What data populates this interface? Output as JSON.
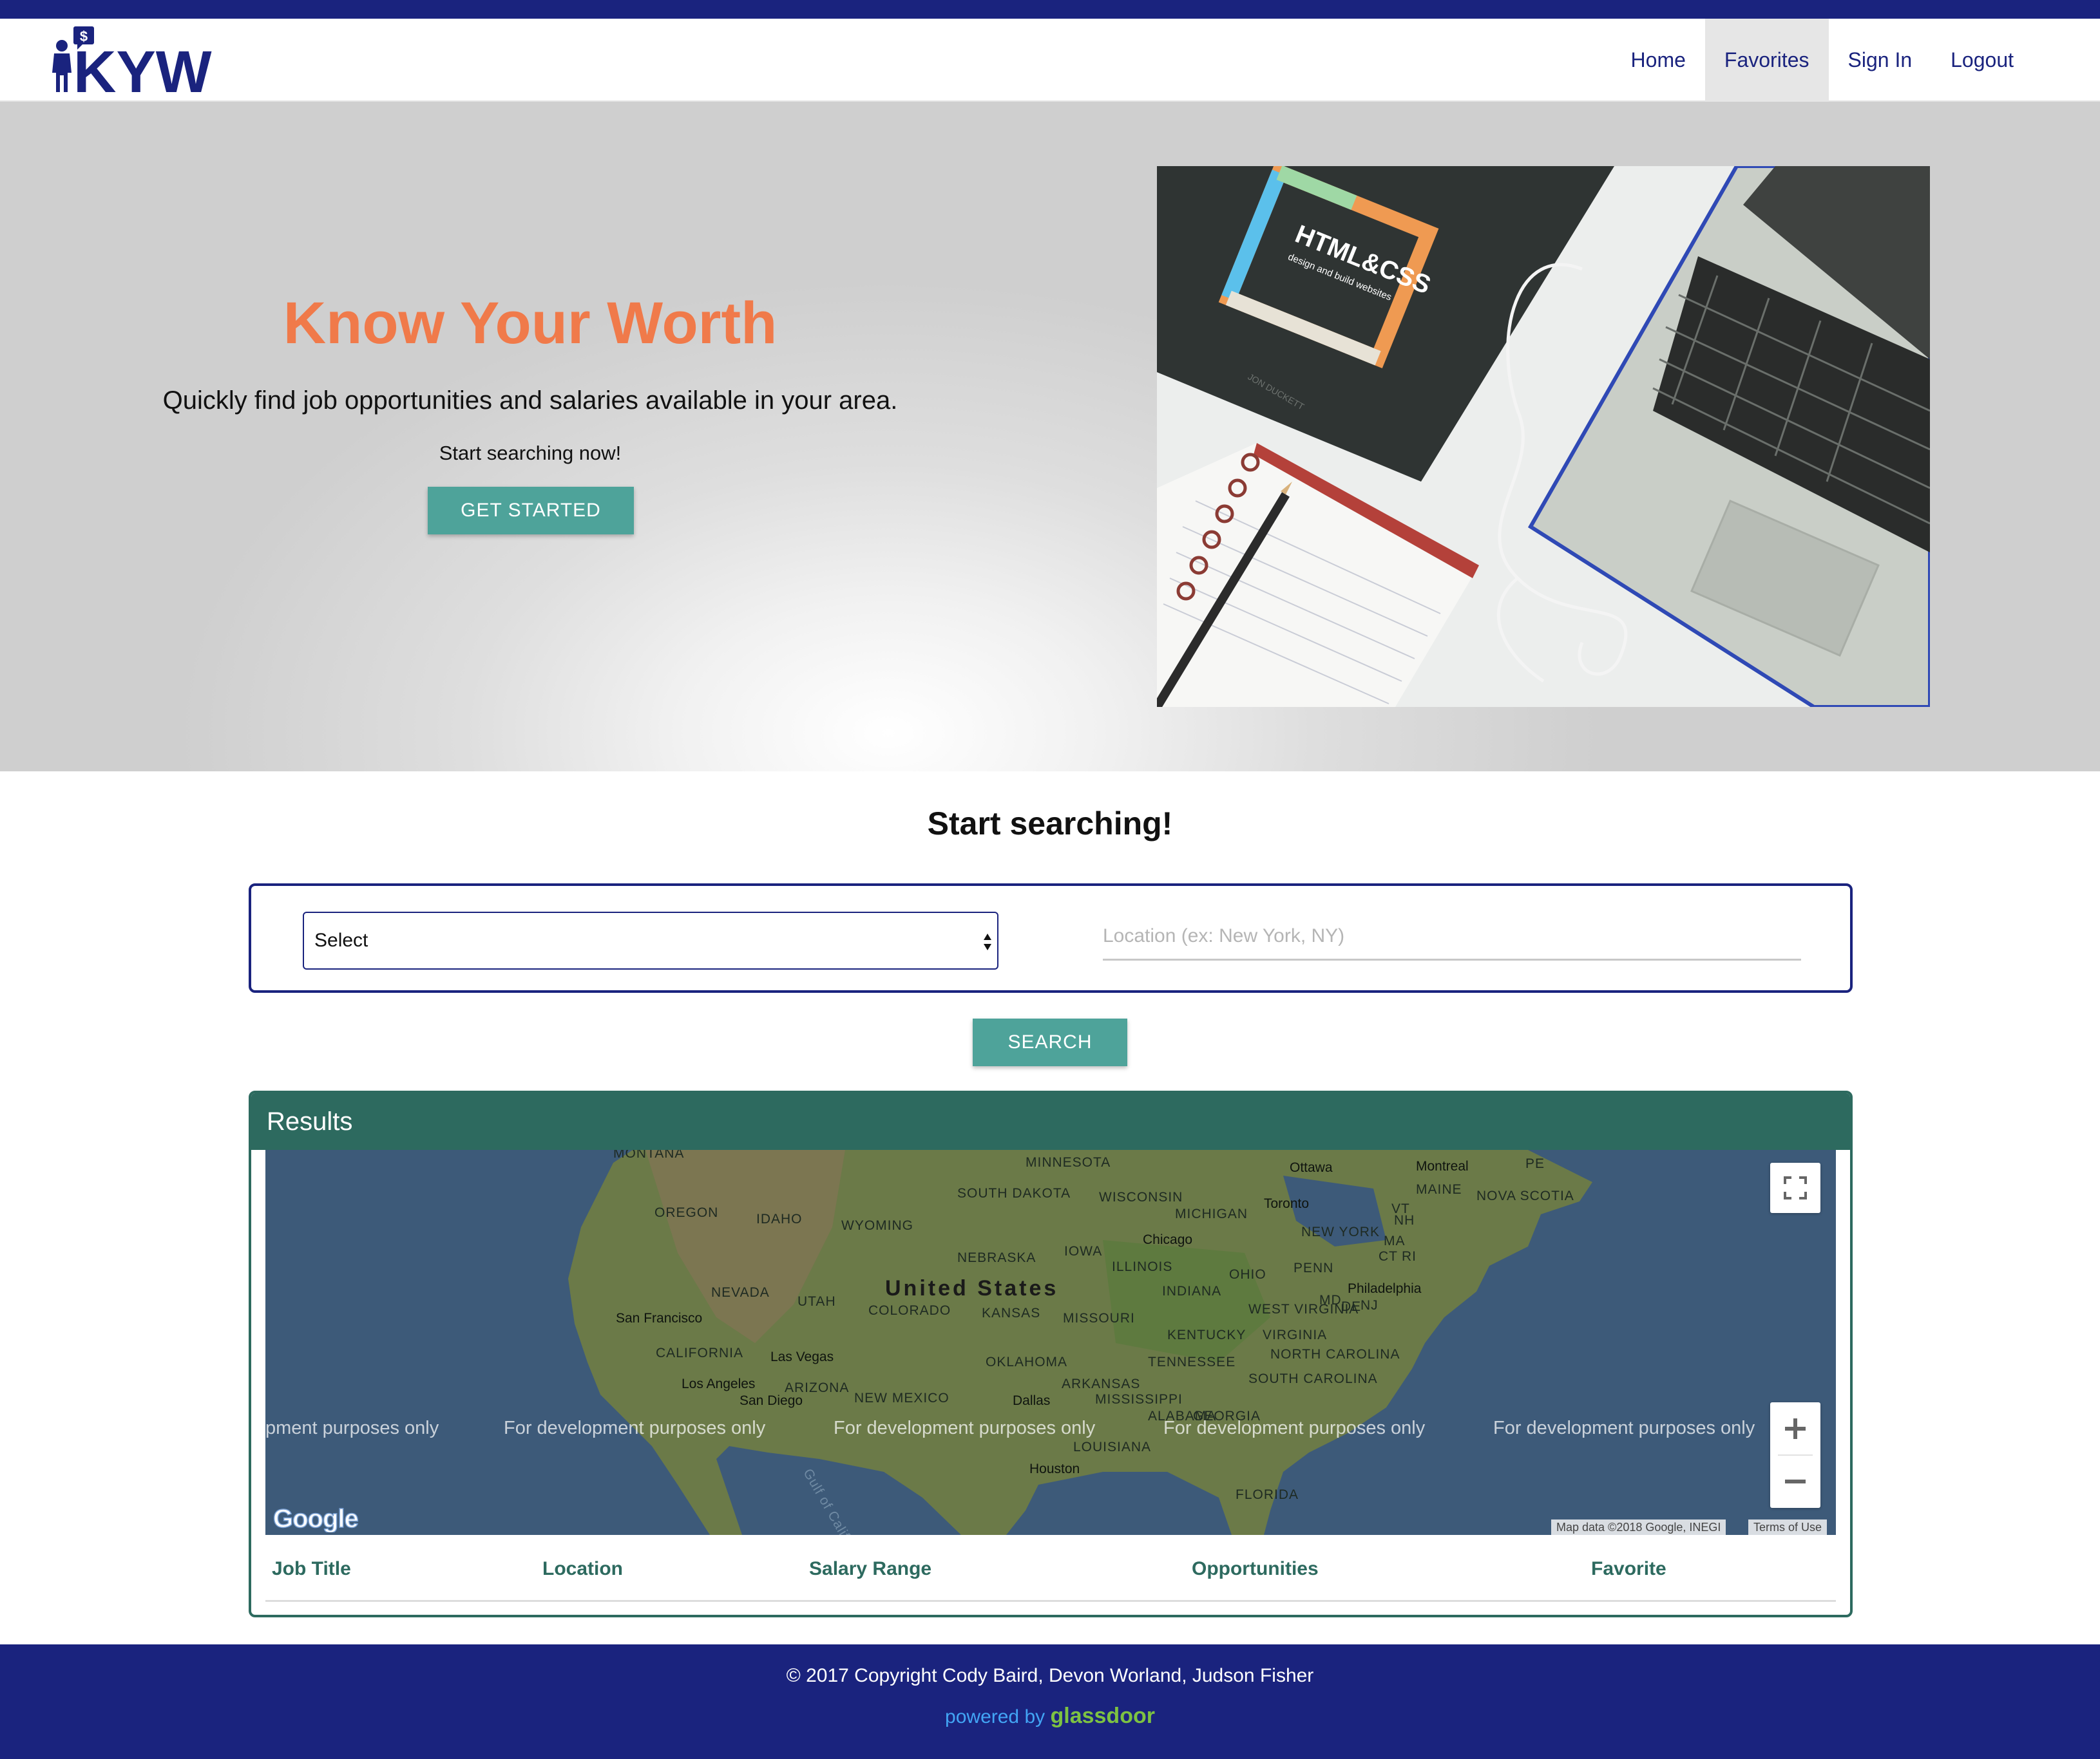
{
  "brand": {
    "logo_text": "KYW",
    "logo_badge": "$"
  },
  "nav": {
    "items": [
      {
        "label": "Home"
      },
      {
        "label": "Favorites"
      },
      {
        "label": "Sign In"
      },
      {
        "label": "Logout"
      }
    ],
    "active": "Favorites"
  },
  "hero": {
    "title": "Know Your Worth",
    "subtitle": "Quickly find job opportunities and salaries available in your area.",
    "cta_text": "Start searching now!",
    "button_label": "GET STARTED",
    "image_book_title": "HTML&CSS",
    "image_book_subtitle": "design and build websites",
    "image_book_author": "JON DUCKETT"
  },
  "search": {
    "title": "Start searching!",
    "select_value": "Select",
    "location_placeholder": "Location (ex: New York, NY)",
    "button_label": "SEARCH"
  },
  "results": {
    "title": "Results",
    "map": {
      "country_label": "United States",
      "watermark": "For development purposes only",
      "watermark_partial": "pment purposes only",
      "attribution": "Map data ©2018 Google, INEGI",
      "terms": "Terms of Use",
      "google_logo": "Google",
      "labels": {
        "montana": "MONTANA",
        "minnesota": "MINNESOTA",
        "ottawa": "Ottawa",
        "montreal": "Montreal",
        "pe": "PE",
        "south_dakota": "SOUTH DAKOTA",
        "wisconsin": "WISCONSIN",
        "maine": "MAINE",
        "nova_scotia": "NOVA SCOTIA",
        "oregon": "OREGON",
        "idaho": "IDAHO",
        "wyoming": "WYOMING",
        "michigan": "MICHIGAN",
        "toronto": "Toronto",
        "vt": "VT",
        "nh": "NH",
        "new_york": "NEW YORK",
        "ma": "MA",
        "ct": "CT",
        "ri": "RI",
        "chicago": "Chicago",
        "nebraska": "NEBRASKA",
        "iowa": "IOWA",
        "illinois": "ILLINOIS",
        "penn": "PENN",
        "ohio": "OHIO",
        "nevada": "NEVADA",
        "utah": "UTAH",
        "colorado": "COLORADO",
        "kansas": "KANSAS",
        "indiana": "INDIANA",
        "philadelphia": "Philadelphia",
        "md": "MD",
        "de": "DE",
        "nj": "NJ",
        "san_francisco": "San Francisco",
        "missouri": "MISSOURI",
        "west_virginia": "WEST VIRGINIA",
        "kentucky": "KENTUCKY",
        "virginia": "VIRGINIA",
        "california": "CALIFORNIA",
        "las_vegas": "Las Vegas",
        "oklahoma": "OKLAHOMA",
        "tennessee": "TENNESSEE",
        "north_carolina": "NORTH CAROLINA",
        "los_angeles": "Los Angeles",
        "arizona": "ARIZONA",
        "arkansas": "ARKANSAS",
        "san_diego": "San Diego",
        "new_mexico": "NEW MEXICO",
        "dallas": "Dallas",
        "mississippi": "MISSISSIPPI",
        "south_carolina": "SOUTH CAROLINA",
        "alabama": "ALABAMA",
        "georgia": "GEORGIA",
        "louisiana": "LOUISIANA",
        "houston": "Houston",
        "florida": "FLORIDA",
        "gulf_of_california": "Gulf of Califo"
      }
    },
    "columns": [
      "Job Title",
      "Location",
      "Salary Range",
      "Opportunities",
      "Favorite"
    ]
  },
  "footer": {
    "copyright": "© 2017 Copyright Cody Baird, Devon Worland, Judson Fisher",
    "powered_by": "powered by",
    "glassdoor": "glassdoor"
  },
  "colors": {
    "navy": "#1a237e",
    "accent_orange": "#f07a4a",
    "teal_button": "#4ea39a",
    "results_green": "#2d6a5f",
    "footer_link": "#42a5f5",
    "glassdoor_green": "#7dc242"
  },
  "icons": {
    "logo": "person-with-dollar-sign-icon",
    "select_arrows": "up-down-arrows-icon",
    "fullscreen": "fullscreen-icon",
    "zoom_in": "plus-icon",
    "zoom_out": "minus-icon"
  }
}
